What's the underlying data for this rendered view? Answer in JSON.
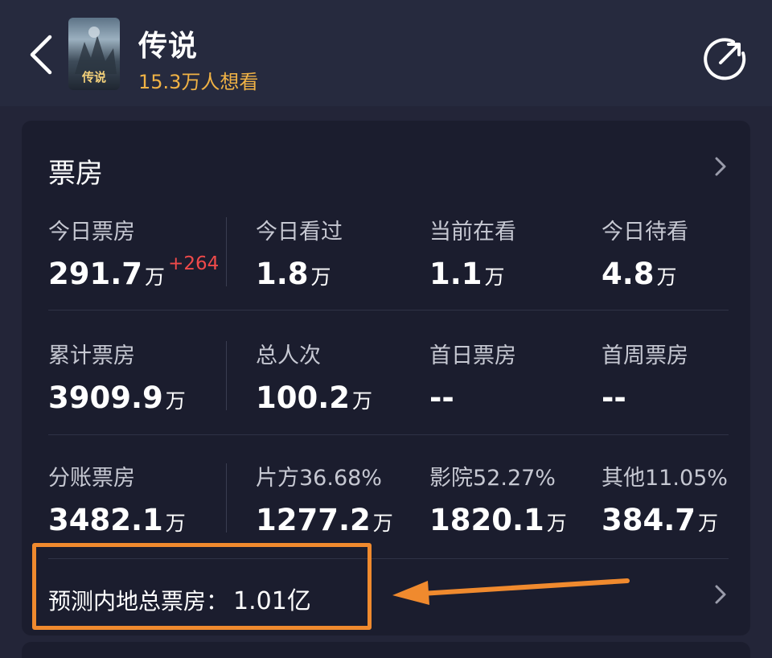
{
  "header": {
    "title": "传说",
    "want_to_watch": "15.3万人想看",
    "poster_text": "传说"
  },
  "box_office": {
    "title": "票房",
    "rows": [
      [
        {
          "label": "今日票房",
          "value": "291.7",
          "unit": "万",
          "delta": "+264"
        },
        {
          "label": "今日看过",
          "value": "1.8",
          "unit": "万"
        },
        {
          "label": "当前在看",
          "value": "1.1",
          "unit": "万"
        },
        {
          "label": "今日待看",
          "value": "4.8",
          "unit": "万"
        }
      ],
      [
        {
          "label": "累计票房",
          "value": "3909.9",
          "unit": "万"
        },
        {
          "label": "总人次",
          "value": "100.2",
          "unit": "万"
        },
        {
          "label": "首日票房",
          "value": "--",
          "unit": ""
        },
        {
          "label": "首周票房",
          "value": "--",
          "unit": ""
        }
      ],
      [
        {
          "label": "分账票房",
          "value": "3482.1",
          "unit": "万"
        },
        {
          "label": "片方36.68%",
          "value": "1277.2",
          "unit": "万"
        },
        {
          "label": "影院52.27%",
          "value": "1820.1",
          "unit": "万"
        },
        {
          "label": "其他11.05%",
          "value": "384.7",
          "unit": "万"
        }
      ]
    ],
    "forecast": {
      "label": "预测内地总票房：",
      "value": "1.01亿"
    }
  },
  "colors": {
    "background": "#232538",
    "card": "#1b1d2e",
    "accent_want": "#f0b245",
    "delta_red": "#ef4a4a",
    "annotation_orange": "#f08a2e"
  },
  "icons": [
    "back-icon",
    "share-icon",
    "chevron-right-icon",
    "annotation-arrow-icon"
  ]
}
